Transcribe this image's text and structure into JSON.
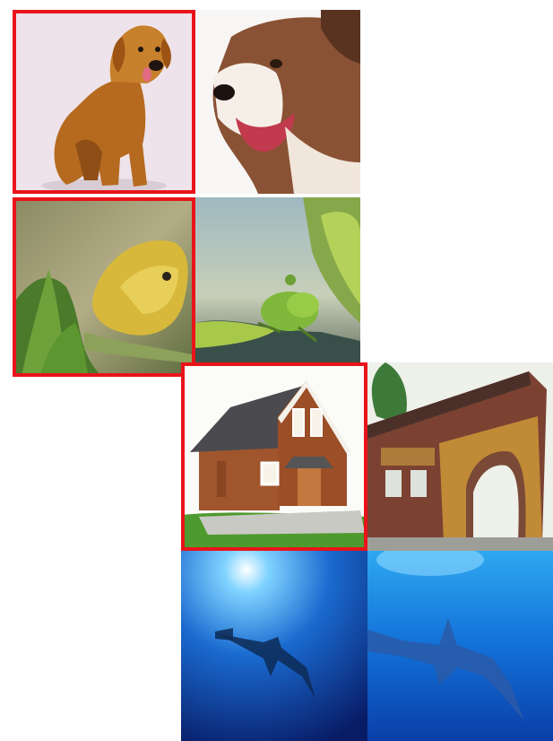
{
  "colors": {
    "selection": "#e8141a",
    "background": "#ffffff"
  },
  "tiles": [
    {
      "name": "golden-retriever",
      "selected": true
    },
    {
      "name": "husky-closeup",
      "selected": false
    },
    {
      "name": "butterfly-on-plant",
      "selected": true
    },
    {
      "name": "green-insect-on-leaf",
      "selected": false
    },
    {
      "name": "wooden-house",
      "selected": true
    },
    {
      "name": "brick-building",
      "selected": false
    },
    {
      "name": "hammerhead-shark-1",
      "selected": false
    },
    {
      "name": "hammerhead-shark-2",
      "selected": false
    }
  ]
}
